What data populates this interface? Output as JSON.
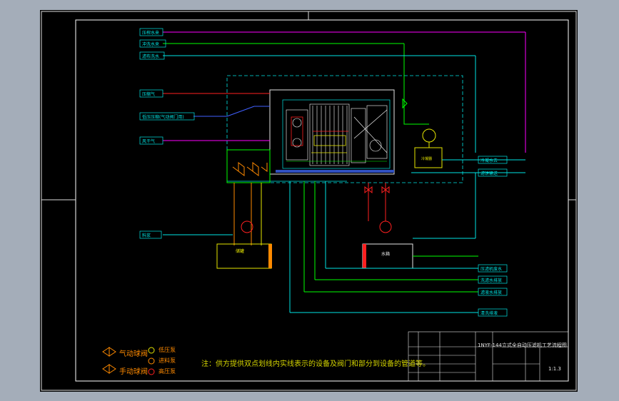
{
  "drawing": {
    "title": "1NYF-144立式全自动压滤机工艺流程图",
    "scale": "1:1.3",
    "note": "注：供方提供双点划线内实线表示的设备及阀门和部分到设备的管道等。"
  },
  "left_inputs": [
    {
      "label": "压榨水来"
    },
    {
      "label": "冲洗水来"
    },
    {
      "label": "滤布洗水"
    },
    {
      "label": "压缩气"
    },
    {
      "label": "低压压缩(气动阀门用)"
    },
    {
      "label": "风干气"
    },
    {
      "label": "料浆"
    }
  ],
  "right_outputs": [
    {
      "label": "冷凝水去"
    },
    {
      "label": "滤饼输送"
    },
    {
      "label": "压滤机废水"
    },
    {
      "label": "洗滤水排放"
    },
    {
      "label": "滤液水排放"
    },
    {
      "label": "清洗排液"
    }
  ],
  "equipment": {
    "tank_left": "储罐",
    "tank_right": "水箱",
    "vessel": "冷凝器"
  },
  "legend": {
    "pneumatic_valve": "气动球阀",
    "manual_valve": "手动球阀",
    "low_pressure_pump": "低压泵",
    "feed_pump": "进料泵",
    "high_pressure_pump": "高压泵"
  },
  "colors": {
    "paper": "#000000",
    "frame": "#ffffff",
    "cyan": "#00e5e5",
    "green": "#00ff00",
    "red": "#ff2020",
    "yellow": "#e6e600",
    "orange": "#ff8a00",
    "magenta": "#ff00ff",
    "blue": "#4060ff"
  }
}
